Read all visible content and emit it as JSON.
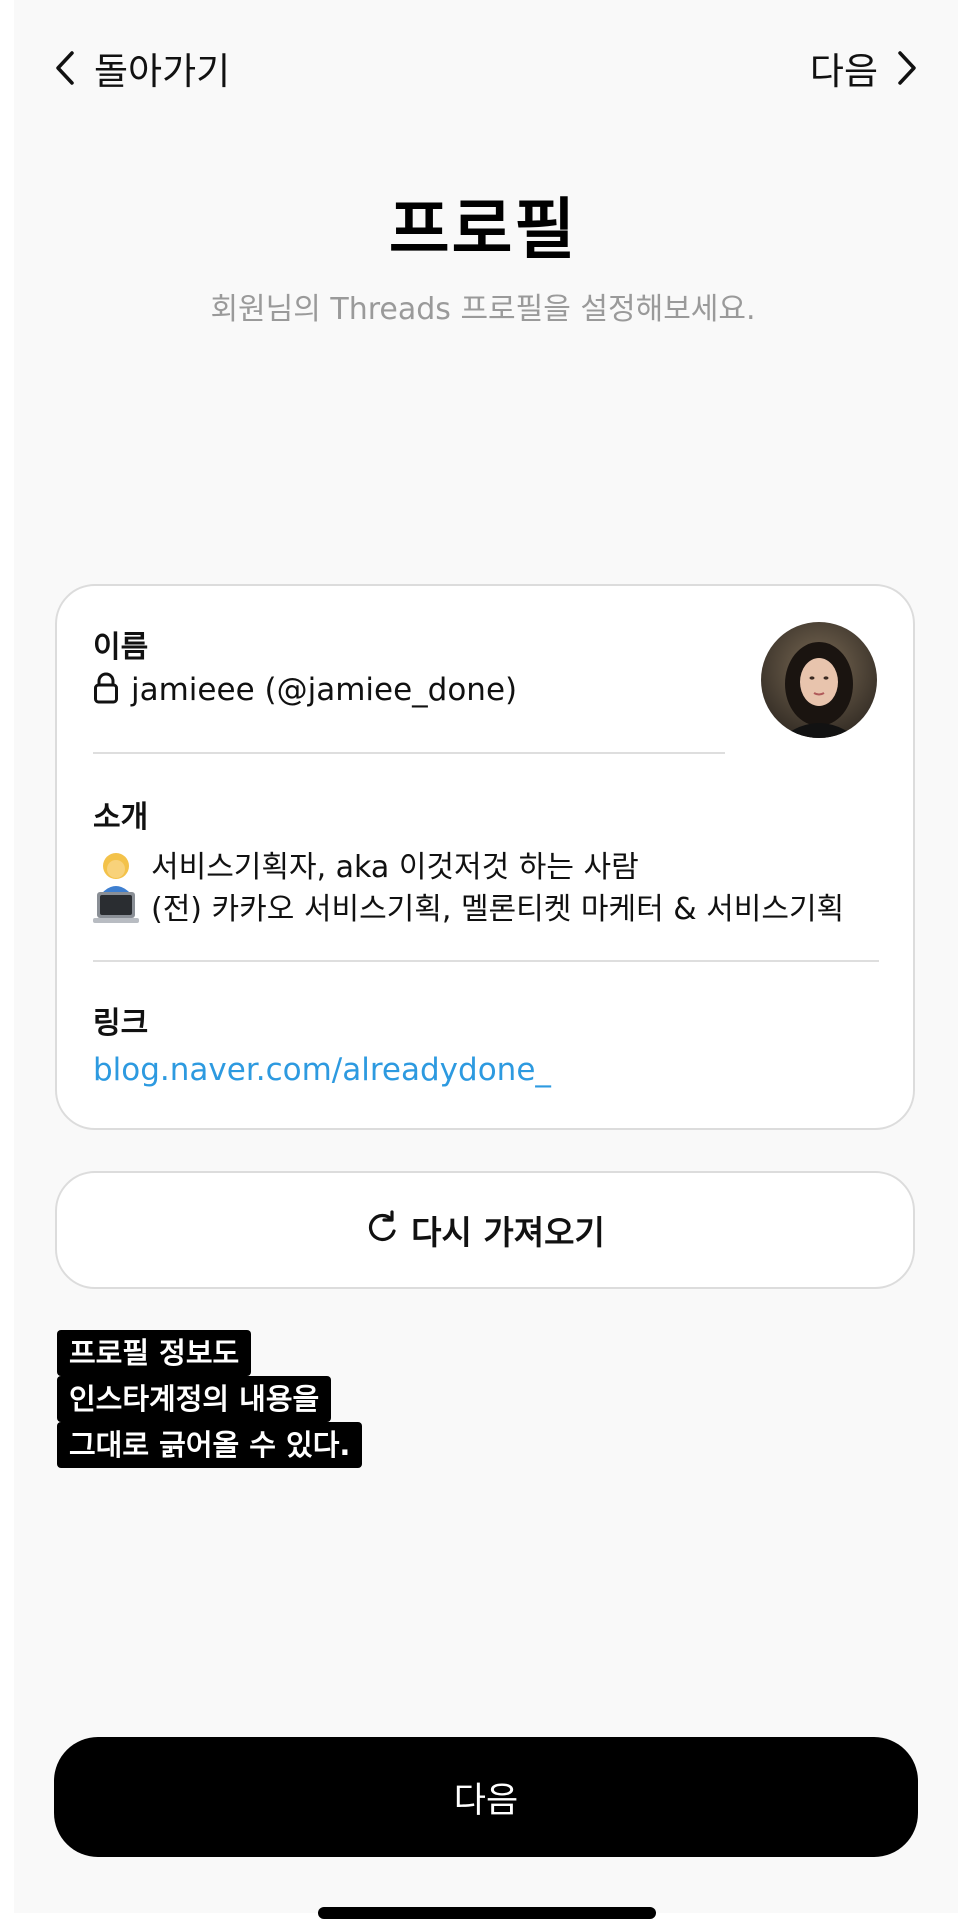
{
  "nav": {
    "back_label": "돌아가기",
    "next_label": "다음"
  },
  "header": {
    "title": "프로필",
    "subtitle": "회원님의 Threads 프로필을 설정해보세요."
  },
  "profile": {
    "name_label": "이름",
    "name_value": "jamieee (@jamiee_done)",
    "bio_label": "소개",
    "bio_line1": "서비스기획자, aka 이것저것 하는 사람",
    "bio_line2": "(전) 카카오 서비스기획, 멜론티켓 마케터 & 서비스기획",
    "link_label": "링크",
    "link_value": "blog.naver.com/alreadydone_"
  },
  "reload_button": {
    "label": "다시 가져오기"
  },
  "caption": {
    "lines": [
      "프로필 정보도",
      "인스타계정의 내용을",
      "그대로 긁어올 수 있다."
    ]
  },
  "next_button": {
    "label": "다음"
  },
  "colors": {
    "link": "#2d9ae0",
    "subtitle": "#9a9a9a",
    "primary_button": "#000000"
  }
}
